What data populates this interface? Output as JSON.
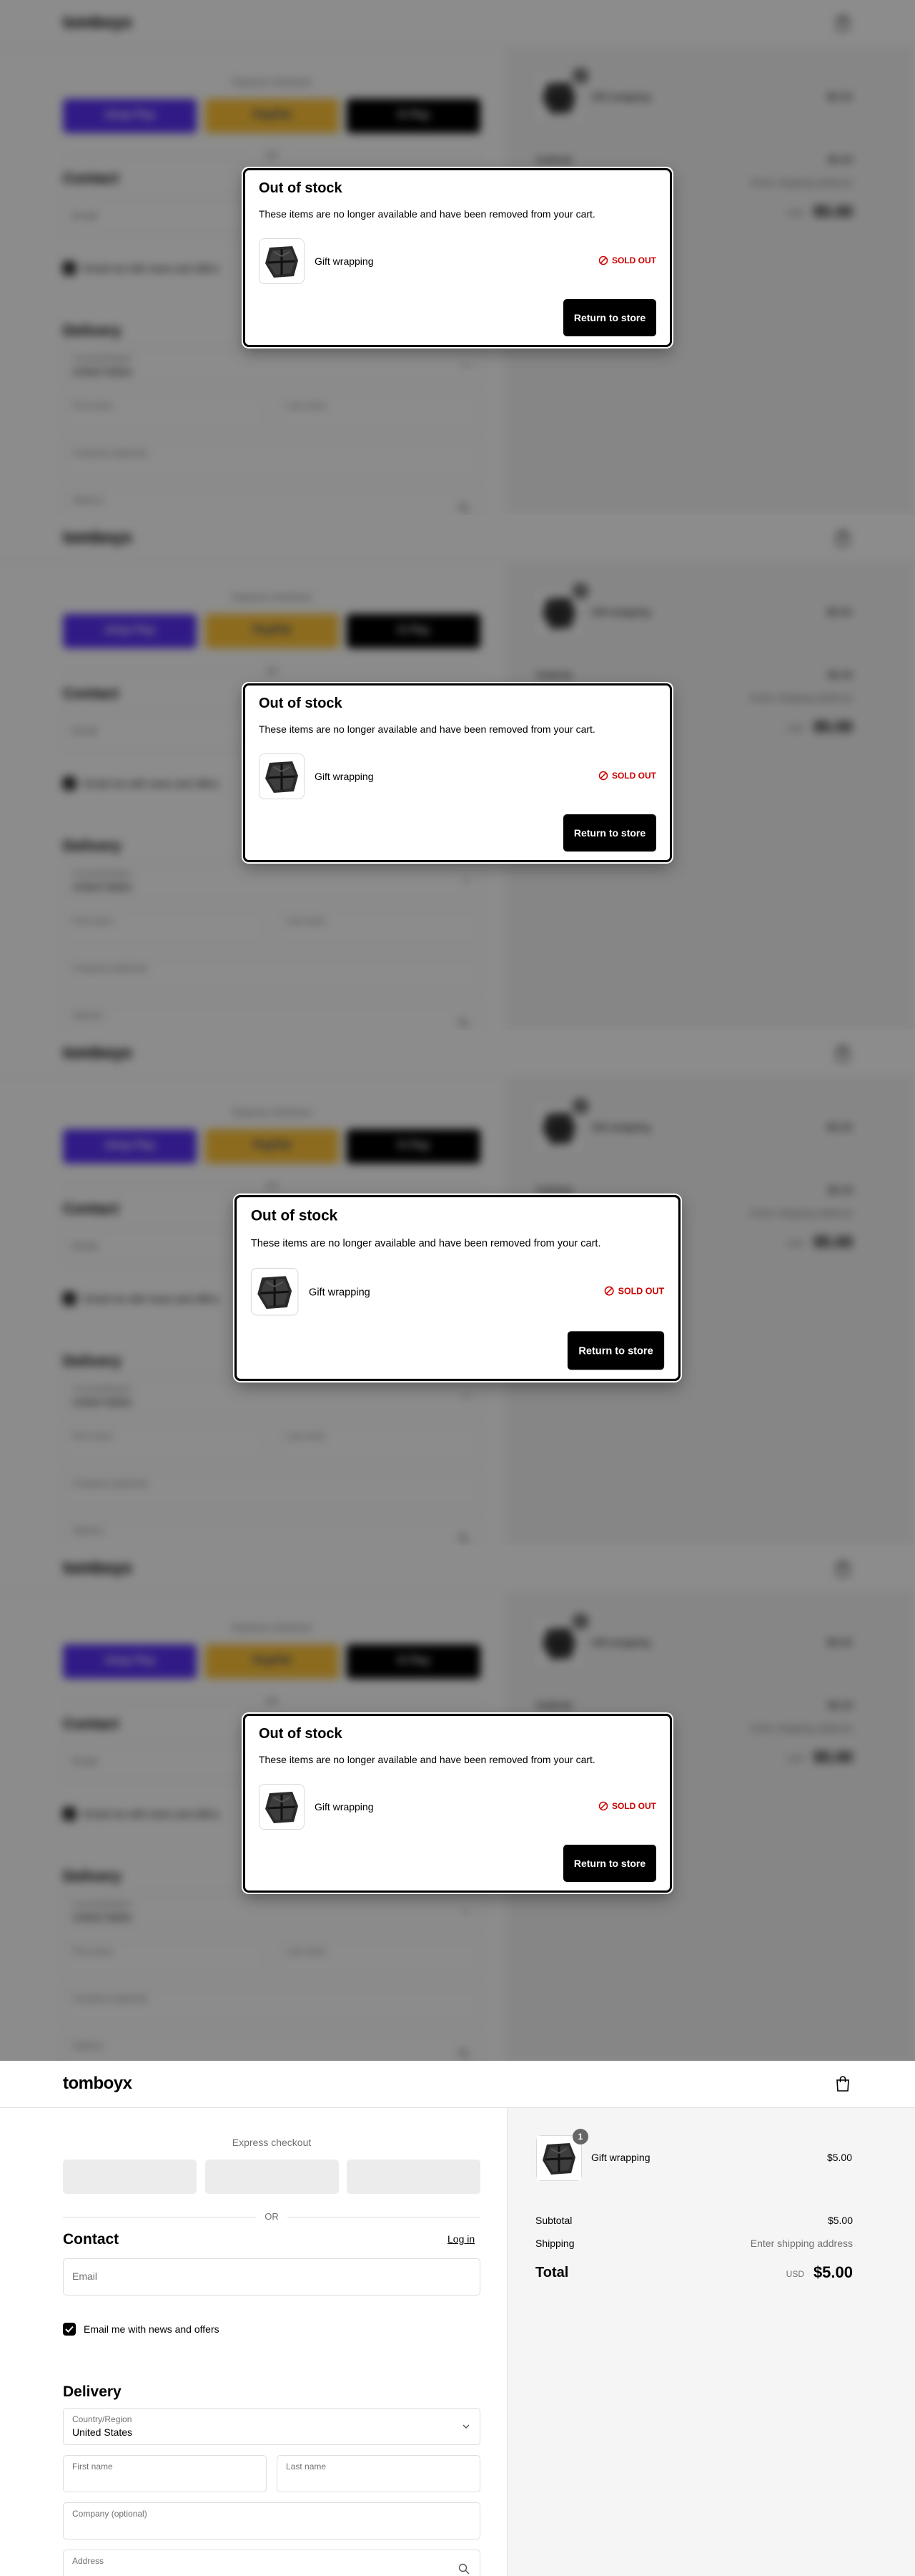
{
  "store": {
    "logo": "tomboyx",
    "bag_icon": "shopping-bag-icon"
  },
  "checkout": {
    "express_title": "Express checkout",
    "payment_buttons": [
      {
        "label": "shop Pay",
        "brand_color": "#5a31f4"
      },
      {
        "label": "PayPal",
        "brand_color": "#ffc439"
      },
      {
        "label": "G Pay",
        "brand_color": "#000000"
      }
    ],
    "or_label": "OR",
    "contact": {
      "heading": "Contact",
      "login_link": "Log in",
      "email_label": "Email",
      "newsletter_label": "Email me with news and offers",
      "newsletter_checked": true
    },
    "delivery": {
      "heading": "Delivery",
      "country_label": "Country/Region",
      "country_value": "United States",
      "first_name_label": "First name",
      "last_name_label": "Last name",
      "company_label": "Company (optional)",
      "address_label": "Address"
    }
  },
  "summary": {
    "item": {
      "name": "Gift wrapping",
      "quantity": "1",
      "price": "$5.00"
    },
    "subtotal_label": "Subtotal",
    "subtotal_value": "$5.00",
    "shipping_label": "Shipping",
    "shipping_value": "Enter shipping address",
    "total_label": "Total",
    "currency": "USD",
    "total_value": "$5.00"
  },
  "modal": {
    "title": "Out of stock",
    "description": "These items are no longer available and have been removed from your cart.",
    "item_name": "Gift wrapping",
    "status": "SOLD OUT",
    "status_color": "#cc0000",
    "button_label": "Return to store"
  }
}
